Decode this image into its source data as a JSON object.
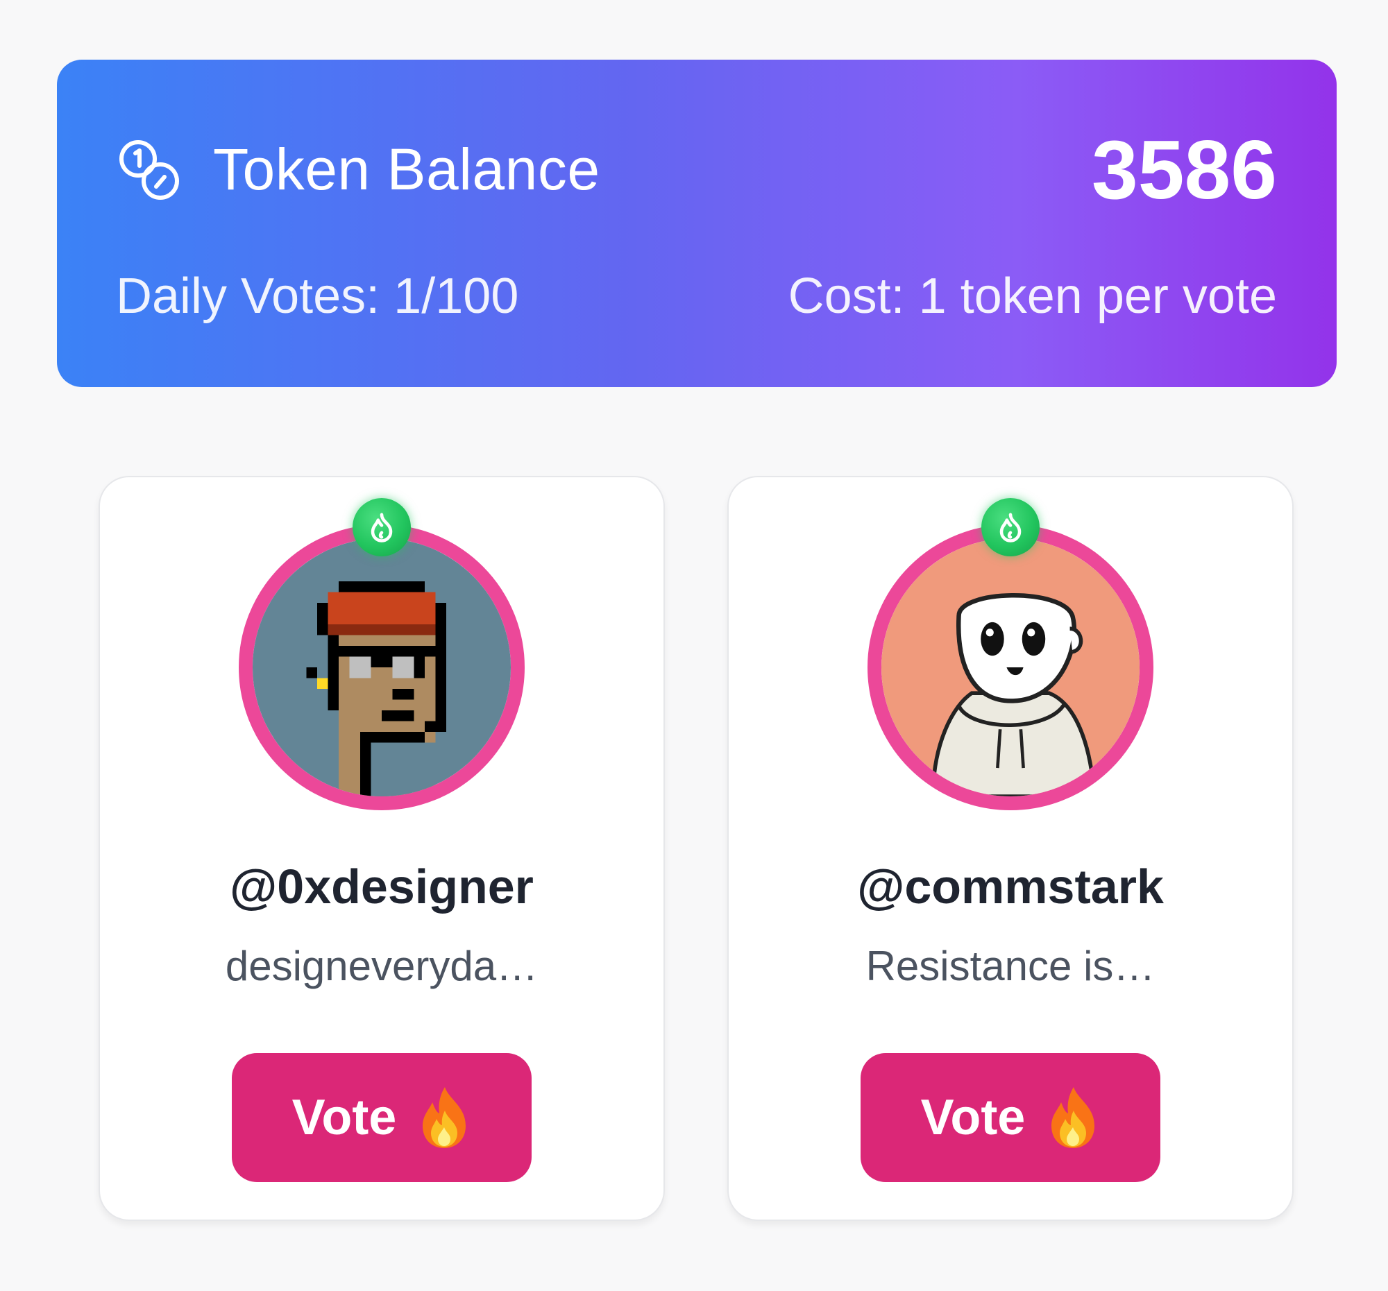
{
  "balance": {
    "icon": "coins-icon",
    "title": "Token Balance",
    "amount": "3586",
    "daily_votes": "Daily Votes: 1/100",
    "cost": "Cost: 1 token per vote"
  },
  "profiles": [
    {
      "handle": "@0xdesigner",
      "bio": "designeveryda…",
      "avatar": "pixel-punk-avatar",
      "badge_icon": "flame-badge-icon",
      "vote_label": "Vote",
      "vote_icon": "fire-emoji-icon"
    },
    {
      "handle": "@commstark",
      "bio": "Resistance is…",
      "avatar": "hoodie-character-avatar",
      "badge_icon": "flame-badge-icon",
      "vote_label": "Vote",
      "vote_icon": "fire-emoji-icon"
    }
  ],
  "colors": {
    "gradient_start": "#3b82f6",
    "gradient_end": "#9333ea",
    "accent_pink": "#db2777",
    "ring_pink": "#ec4899",
    "badge_green": "#22c55e"
  }
}
